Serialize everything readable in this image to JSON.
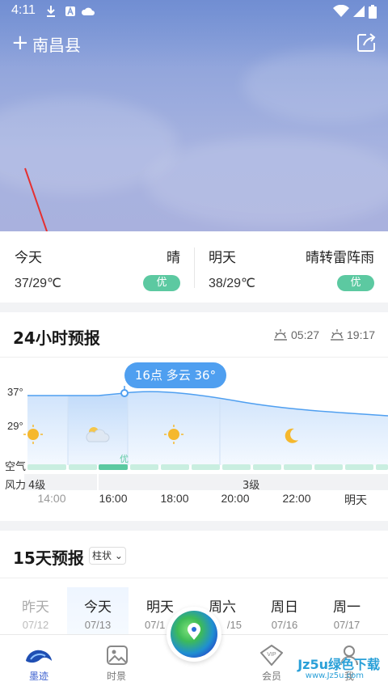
{
  "status_bar": {
    "time": "4:11"
  },
  "header": {
    "add_symbol": "+",
    "city": "南昌县"
  },
  "today_summary": {
    "today": {
      "label": "今天",
      "condition": "晴",
      "temp": "37/29℃",
      "aqi": "优"
    },
    "tomorrow": {
      "label": "明天",
      "condition": "晴转雷阵雨",
      "temp": "38/29℃",
      "aqi": "优"
    }
  },
  "hourly": {
    "title": "24小时预报",
    "sunrise": "05:27",
    "sunset": "19:17",
    "tooltip": "16点 多云 36°",
    "y_labels": [
      "37°",
      "29°"
    ],
    "air_label": "空气",
    "air_badge": "优",
    "wind_label": "风力",
    "wind_left": "4级",
    "wind_right": "3级",
    "ticks": [
      "14:00",
      "16:00",
      "18:00",
      "20:00",
      "22:00",
      "明天"
    ]
  },
  "daily": {
    "title": "15天预报",
    "mode": "柱状",
    "days": [
      {
        "name": "昨天",
        "date": "07/12"
      },
      {
        "name": "今天",
        "date": "07/13"
      },
      {
        "name": "明天",
        "date": "07/1"
      },
      {
        "name": "周六",
        "date": "/15"
      },
      {
        "name": "周日",
        "date": "07/16"
      },
      {
        "name": "周一",
        "date": "07/17"
      }
    ]
  },
  "tabbar": {
    "tabs": [
      {
        "label": "墨迹"
      },
      {
        "label": "时景"
      },
      {
        "label": "会员"
      },
      {
        "label": "我"
      }
    ]
  },
  "watermark": {
    "main": "Jz5u绿色下载",
    "sub": "www.Jz5u.com"
  },
  "colors": {
    "accent": "#4f9ff0",
    "aqi_good": "#5cc9a1",
    "tab_active": "#3b5fcf"
  }
}
